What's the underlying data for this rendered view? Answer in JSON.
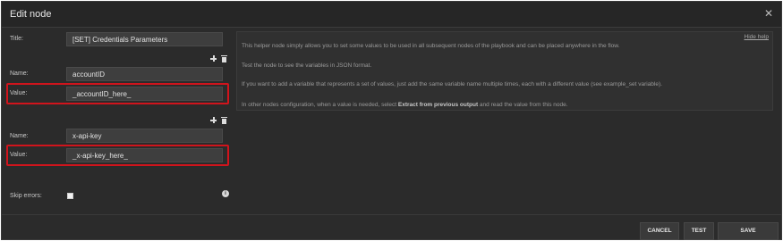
{
  "modal": {
    "title": "Edit node"
  },
  "form": {
    "title_label": "Title:",
    "title_value": "[SET] Credentials Parameters",
    "variables": [
      {
        "name_label": "Name:",
        "name_value": "accountID",
        "value_label": "Value:",
        "value_value": "_accountID_here_"
      },
      {
        "name_label": "Name:",
        "name_value": "x-api-key",
        "value_label": "Value:",
        "value_value": "_x-api-key_here_"
      }
    ],
    "skip_errors_label": "Skip errors:",
    "skip_errors_checked": false
  },
  "help": {
    "hide_label": "Hide help",
    "line1": "This helper node simply allows you to set some values to be used in all subsequent nodes of the playbook and can be placed anywhere in the flow.",
    "line2": "Test the node to see the variables in JSON format.",
    "line3": "If you want to add a variable that represents a set of values, just add the same variable name multiple times, each with a different value (see example_set variable).",
    "line4_prefix": "In other nodes configuration, when a value is needed, select ",
    "line4_bold": "Extract from previous output",
    "line4_suffix": " and read the value from this node."
  },
  "buttons": {
    "cancel": "CANCEL",
    "test": "TEST",
    "save": "SAVE"
  },
  "icons": {
    "close": "close-icon",
    "add": "plus-icon",
    "delete": "trash-icon",
    "info": "info-icon"
  },
  "colors": {
    "highlight": "#d0141c",
    "background": "#2b2b2b"
  }
}
